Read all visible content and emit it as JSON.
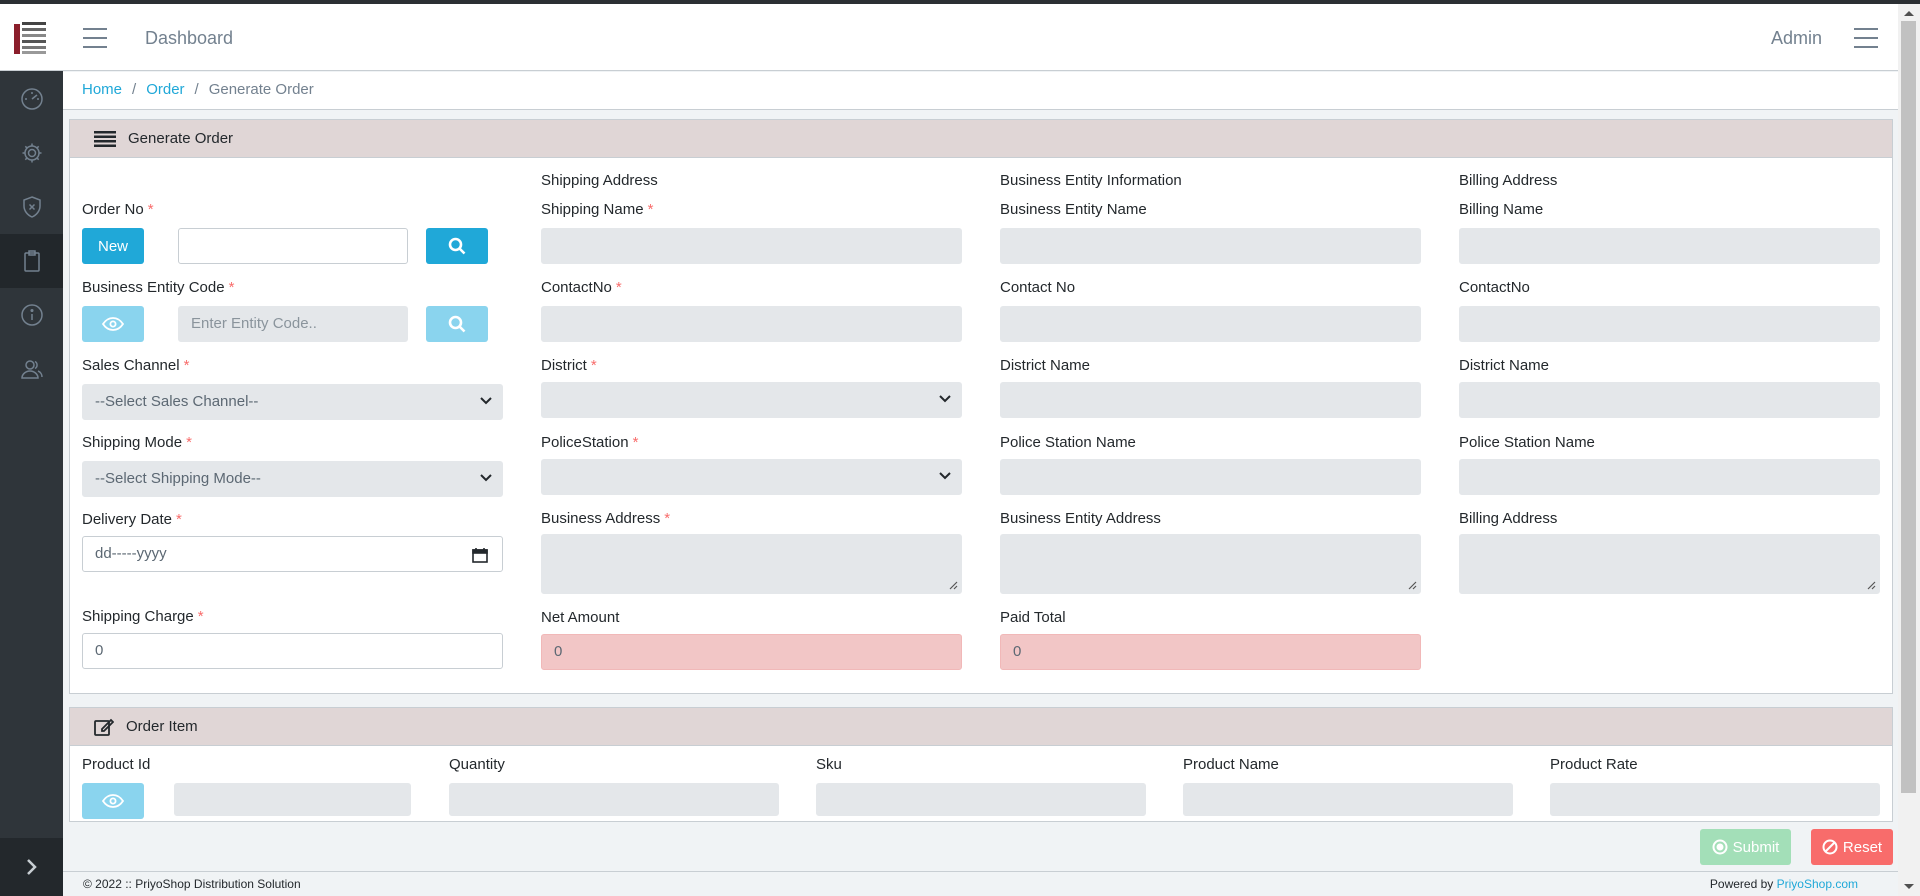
{
  "header": {
    "title": "Dashboard",
    "user": "Admin"
  },
  "breadcrumb": {
    "home": "Home",
    "order": "Order",
    "current": "Generate Order"
  },
  "generate_card": {
    "title": "Generate Order",
    "section_shipping": "Shipping Address",
    "section_business": "Business Entity Information",
    "section_billing": "Billing Address"
  },
  "left_col": {
    "order_no_label": "Order No",
    "new_button": "New",
    "entity_code_label": "Business Entity Code",
    "entity_code_placeholder": "Enter Entity Code..",
    "sales_channel_label": "Sales Channel",
    "sales_channel_value": "--Select Sales Channel--",
    "shipping_mode_label": "Shipping Mode",
    "shipping_mode_value": "--Select Shipping Mode--",
    "delivery_date_label": "Delivery Date",
    "delivery_date_value": "dd-----yyyy",
    "shipping_charge_label": "Shipping Charge",
    "shipping_charge_value": "0"
  },
  "shipping_col": {
    "name_label": "Shipping Name",
    "contact_label": "ContactNo",
    "district_label": "District",
    "police_label": "PoliceStation",
    "address_label": "Business Address",
    "net_amount_label": "Net Amount",
    "net_amount_value": "0"
  },
  "business_col": {
    "name_label": "Business Entity Name",
    "contact_label": "Contact No",
    "district_label": "District Name",
    "police_label": "Police Station Name",
    "address_label": "Business Entity Address",
    "paid_total_label": "Paid Total",
    "paid_total_value": "0"
  },
  "billing_col": {
    "name_label": "Billing Name",
    "contact_label": "ContactNo",
    "district_label": "District Name",
    "police_label": "Police Station Name",
    "address_label": "Billing Address"
  },
  "order_item_card": {
    "title": "Order Item",
    "product_id_label": "Product Id",
    "quantity_label": "Quantity",
    "sku_label": "Sku",
    "product_name_label": "Product Name",
    "product_rate_label": "Product Rate"
  },
  "actions": {
    "submit": "Submit",
    "reset": "Reset"
  },
  "footer": {
    "copyright": "© 2022 :: PriyoShop Distribution Solution",
    "powered_by": "Powered by",
    "powered_link": "PriyoShop.com"
  },
  "colors": {
    "primary": "#20a8d8",
    "light_primary": "#8ad4ee",
    "success_faded": "#a3dfb8",
    "danger": "#f86c6b",
    "sidebar": "#2f353a"
  }
}
